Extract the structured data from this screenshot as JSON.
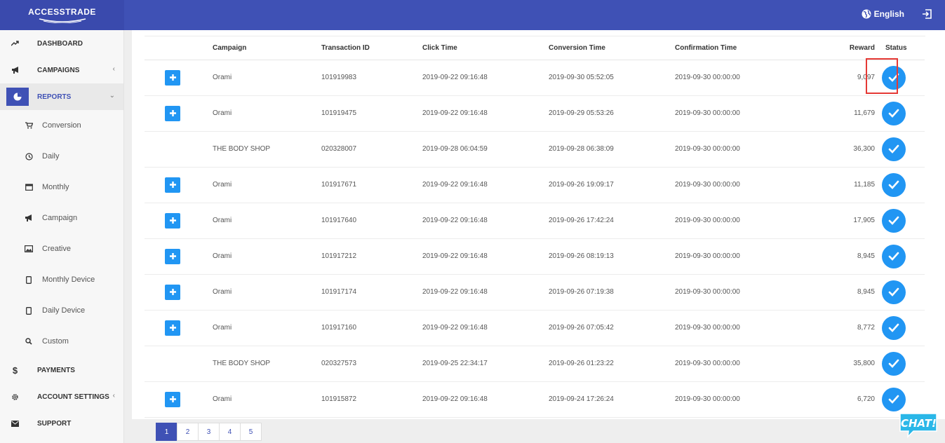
{
  "app": {
    "logo_text": "ACCESSTRADE",
    "language": "English"
  },
  "colors": {
    "primary": "#3f51b5",
    "accent": "#2196f3",
    "highlight": "#e53935"
  },
  "sidebar": {
    "items": [
      {
        "label": "DASHBOARD",
        "icon": "trend-icon"
      },
      {
        "label": "CAMPAIGNS",
        "icon": "megaphone-icon"
      },
      {
        "label": "REPORTS",
        "icon": "pie-chart-icon"
      },
      {
        "label": "PAYMENTS",
        "icon": "dollar-icon"
      },
      {
        "label": "ACCOUNT SETTINGS",
        "icon": "gear-icon"
      },
      {
        "label": "SUPPORT",
        "icon": "envelope-icon"
      }
    ],
    "reports_sub": [
      {
        "label": "Conversion",
        "icon": "cart-icon"
      },
      {
        "label": "Daily",
        "icon": "clock-icon"
      },
      {
        "label": "Monthly",
        "icon": "calendar-icon"
      },
      {
        "label": "Campaign",
        "icon": "megaphone-icon"
      },
      {
        "label": "Creative",
        "icon": "image-icon"
      },
      {
        "label": "Monthly Device",
        "icon": "mobile-icon"
      },
      {
        "label": "Daily Device",
        "icon": "mobile-icon"
      },
      {
        "label": "Custom",
        "icon": "search-icon"
      }
    ]
  },
  "table": {
    "headers": [
      "Campaign",
      "Transaction ID",
      "Click Time",
      "Conversion Time",
      "Confirmation Time",
      "Reward",
      "Status"
    ],
    "rows": [
      {
        "expand": true,
        "campaign": "Orami",
        "tid": "101919983",
        "click": "2019-09-22 09:16:48",
        "conv": "2019-09-30 05:52:05",
        "conf": "2019-09-30 00:00:00",
        "reward": "9,097"
      },
      {
        "expand": true,
        "campaign": "Orami",
        "tid": "101919475",
        "click": "2019-09-22 09:16:48",
        "conv": "2019-09-29 05:53:26",
        "conf": "2019-09-30 00:00:00",
        "reward": "11,679"
      },
      {
        "expand": false,
        "campaign": "THE BODY SHOP",
        "tid": "020328007",
        "click": "2019-09-28 06:04:59",
        "conv": "2019-09-28 06:38:09",
        "conf": "2019-09-30 00:00:00",
        "reward": "36,300"
      },
      {
        "expand": true,
        "campaign": "Orami",
        "tid": "101917671",
        "click": "2019-09-22 09:16:48",
        "conv": "2019-09-26 19:09:17",
        "conf": "2019-09-30 00:00:00",
        "reward": "11,185"
      },
      {
        "expand": true,
        "campaign": "Orami",
        "tid": "101917640",
        "click": "2019-09-22 09:16:48",
        "conv": "2019-09-26 17:42:24",
        "conf": "2019-09-30 00:00:00",
        "reward": "17,905"
      },
      {
        "expand": true,
        "campaign": "Orami",
        "tid": "101917212",
        "click": "2019-09-22 09:16:48",
        "conv": "2019-09-26 08:19:13",
        "conf": "2019-09-30 00:00:00",
        "reward": "8,945"
      },
      {
        "expand": true,
        "campaign": "Orami",
        "tid": "101917174",
        "click": "2019-09-22 09:16:48",
        "conv": "2019-09-26 07:19:38",
        "conf": "2019-09-30 00:00:00",
        "reward": "8,945"
      },
      {
        "expand": true,
        "campaign": "Orami",
        "tid": "101917160",
        "click": "2019-09-22 09:16:48",
        "conv": "2019-09-26 07:05:42",
        "conf": "2019-09-30 00:00:00",
        "reward": "8,772"
      },
      {
        "expand": false,
        "campaign": "THE BODY SHOP",
        "tid": "020327573",
        "click": "2019-09-25 22:34:17",
        "conv": "2019-09-26 01:23:22",
        "conf": "2019-09-30 00:00:00",
        "reward": "35,800"
      },
      {
        "expand": true,
        "campaign": "Orami",
        "tid": "101915872",
        "click": "2019-09-22 09:16:48",
        "conv": "2019-09-24 17:26:24",
        "conf": "2019-09-30 00:00:00",
        "reward": "6,720"
      }
    ]
  },
  "pagination": {
    "pages": [
      "1",
      "2",
      "3",
      "4",
      "5"
    ],
    "current": "1"
  },
  "chat": {
    "label": "CHAT!"
  }
}
